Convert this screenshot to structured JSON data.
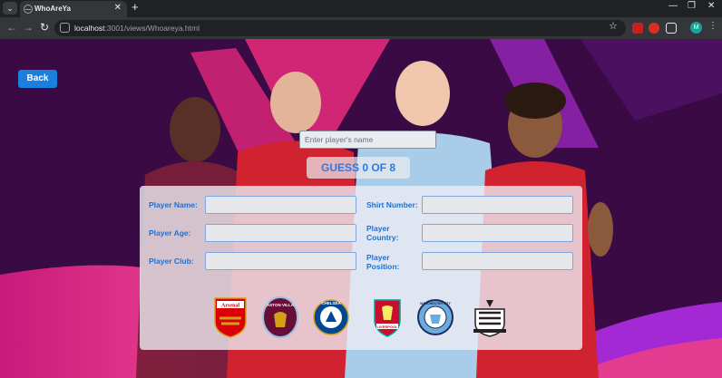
{
  "browser": {
    "tab_title": "WhoAreYa",
    "url_host": "localhost",
    "url_rest": ":3001/views/Whoareya.html",
    "profile_initial": "M"
  },
  "page": {
    "back_label": "Back",
    "search_placeholder": "Enter player's name",
    "guess_label": "GUESS 0 OF 8",
    "fields": {
      "player_name": "Player Name:",
      "shirt_number": "Shirt Number:",
      "player_age": "Player Age:",
      "player_country": "Player Country:",
      "player_club": "Player Club:",
      "player_position": "Player Position:"
    },
    "crests": [
      {
        "icon": "arsenal-crest-icon",
        "text": "Arsenal",
        "color": "#db0007"
      },
      {
        "icon": "aston-villa-crest-icon",
        "text": "ASTON VILLA",
        "color": "#670e36"
      },
      {
        "icon": "chelsea-crest-icon",
        "text": "CHELSEA",
        "color": "#034694"
      },
      {
        "icon": "liverpool-crest-icon",
        "text": "LIVERPOOL",
        "color": "#c8102e"
      },
      {
        "icon": "manchester-city-crest-icon",
        "text": "MANCHESTER CITY",
        "color": "#6cabdd"
      },
      {
        "icon": "newcastle-crest-icon",
        "text": "",
        "color": "#241f20"
      }
    ]
  }
}
